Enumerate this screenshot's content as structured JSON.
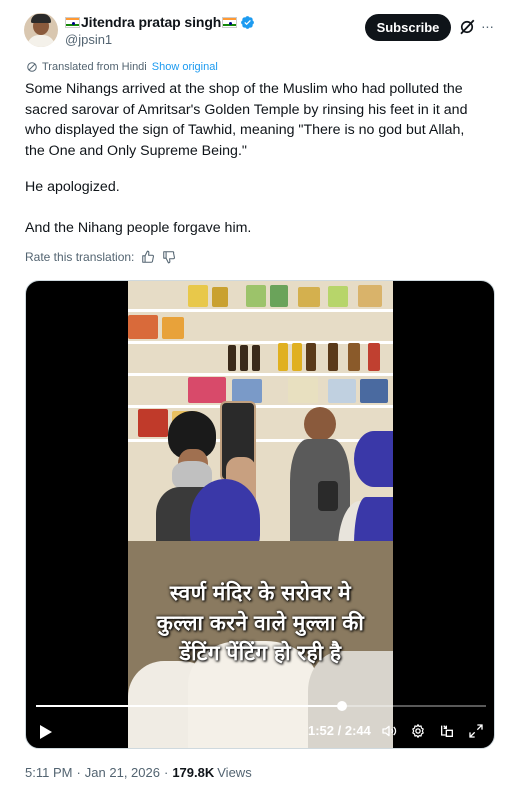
{
  "author": {
    "display_name": "Jitendra pratap singh",
    "handle": "@jpsin1",
    "flag_icon": "indian-flag-icon",
    "verified_color": "#1d9bf0"
  },
  "header": {
    "subscribe_label": "Subscribe",
    "more_label": "···"
  },
  "translation": {
    "label": "Translated from Hindi",
    "show_original": "Show original",
    "rate_label": "Rate this translation:"
  },
  "tweet": {
    "paragraph_1": "Some Nihangs arrived at the shop of the Muslim who had polluted the sacred sarovar of Amritsar's Golden Temple by rinsing his feet in it and who displayed the sign of Tawhid, meaning \"There is no god but Allah, the One and Only Supreme Being.\"",
    "paragraph_2": "He apologized.",
    "paragraph_3": "And the Nihang people forgave him."
  },
  "video": {
    "caption_line_1": "स्वर्ण मंदिर के सरोवर मे",
    "caption_line_2": "कुल्ला करने वाले मुल्ला की",
    "caption_line_3": "डेंटिंग पेंटिंग हो रही है",
    "time_display": "1:52 / 2:44",
    "progress": 0.68
  },
  "footer": {
    "time": "5:11 PM",
    "date": "Jan 21, 2026",
    "views_count": "179.8K",
    "views_label": "Views",
    "separator": "·"
  },
  "colors": {
    "accent": "#1d9bf0",
    "text": "#0f1419",
    "muted": "#536471"
  }
}
